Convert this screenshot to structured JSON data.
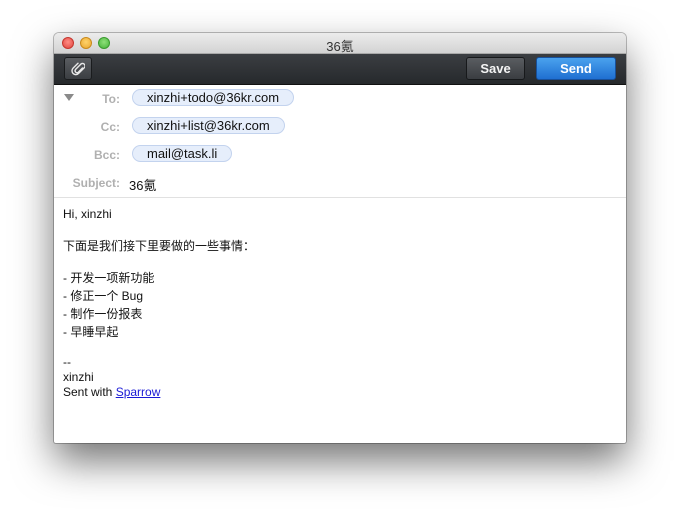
{
  "window": {
    "title": "36氪"
  },
  "toolbar": {
    "attach_icon": "paperclip-icon",
    "save_label": "Save",
    "send_label": "Send",
    "send_color": "#2a7fe0"
  },
  "headers": {
    "to": {
      "label": "To:",
      "value": "xinzhi+todo@36kr.com"
    },
    "cc": {
      "label": "Cc:",
      "value": "xinzhi+list@36kr.com"
    },
    "bcc": {
      "label": "Bcc:",
      "value": "mail@task.li"
    },
    "subject": {
      "label": "Subject:",
      "value": "36氪"
    }
  },
  "body": {
    "greeting": "Hi, xinzhi",
    "intro": "下面是我们接下里要做的一些事情：",
    "items": [
      "- 开发一项新功能",
      "- 修正一个 Bug",
      "- 制作一份报表",
      "- 早睡早起"
    ],
    "sig_dashes": "--",
    "sig_name": "xinzhi",
    "sent_with_prefix": "Sent with ",
    "sent_with_link": "Sparrow"
  }
}
